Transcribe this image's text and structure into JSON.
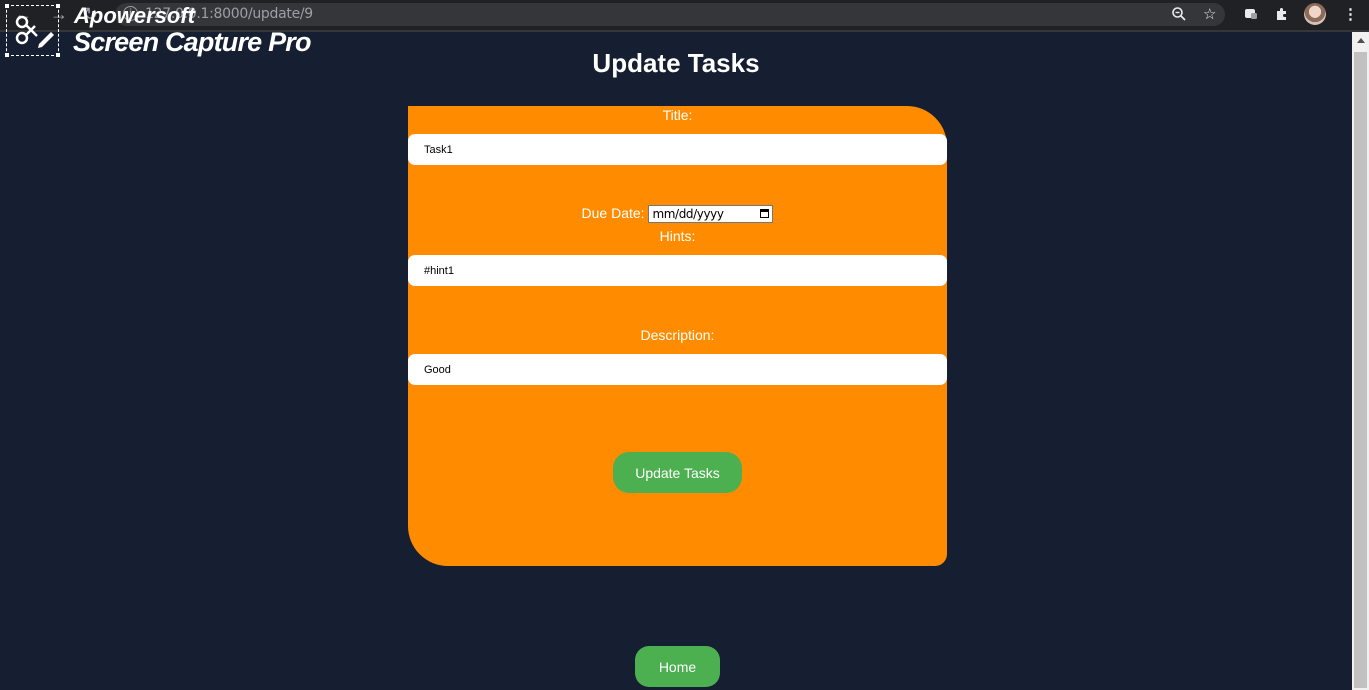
{
  "browser": {
    "url": "127.0.0.1:8000/update/9",
    "back_icon": "back-arrow-icon",
    "forward_icon": "forward-arrow-icon",
    "reload_icon": "reload-icon",
    "info_icon": "info-icon",
    "zoom_icon": "zoom-icon",
    "star_icon": "star-icon",
    "extension_icon": "extension-icon",
    "puzzle_icon": "puzzle-icon",
    "menu_icon": "kebab-menu-icon"
  },
  "watermark": {
    "line1": "Apowersoft",
    "line2": "Screen Capture Pro"
  },
  "page": {
    "title": "Update Tasks"
  },
  "form": {
    "title_label": "Title:",
    "title_value": "Task1",
    "due_date_label": "Due Date:",
    "due_date_placeholder": "mm/dd/yyyy",
    "hints_label": "Hints:",
    "hints_value": "#hint1",
    "description_label": "Description:",
    "description_value": "Good",
    "submit_label": "Update Tasks"
  },
  "home_button": {
    "label": "Home"
  },
  "colors": {
    "background": "#161e31",
    "card": "#ff8c00",
    "button": "#4caf50"
  }
}
